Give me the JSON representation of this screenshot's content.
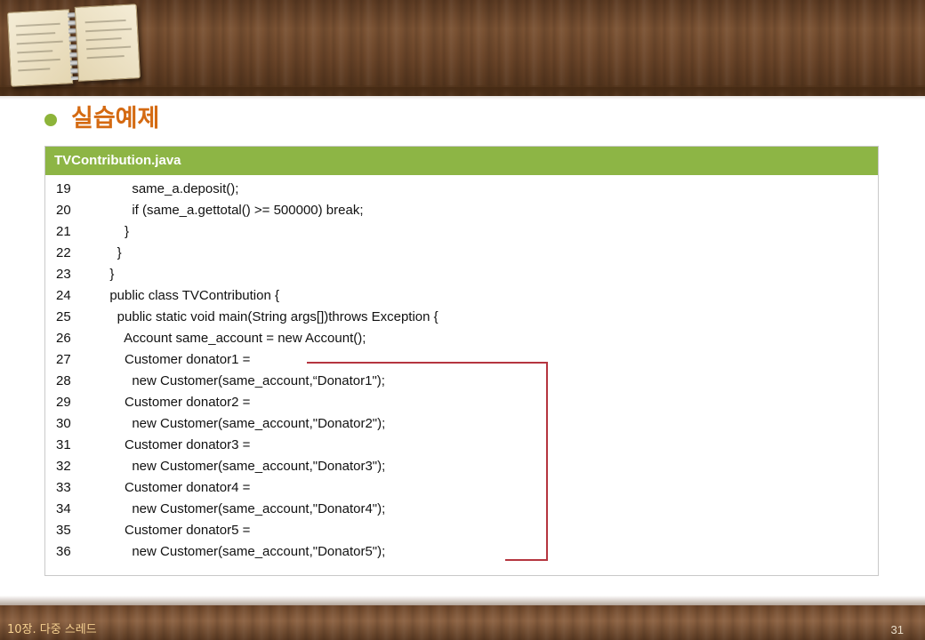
{
  "slide": {
    "title": "실습예제",
    "footer_chapter": "10장. 다중 스레드",
    "page_number": "31"
  },
  "code_box": {
    "filename": "TVContribution.java",
    "lines": [
      {
        "no": "19",
        "code": "        same_a.deposit();"
      },
      {
        "no": "20",
        "code": "        if (same_a.gettotal() >= 500000) break;"
      },
      {
        "no": "21",
        "code": "      }"
      },
      {
        "no": "22",
        "code": "    }"
      },
      {
        "no": "23",
        "code": "  }"
      },
      {
        "no": "24",
        "code": "  public class TVContribution {"
      },
      {
        "no": "25",
        "code": "    public static void main(String args[])throws Exception {"
      },
      {
        "no": "26",
        "code": "      Account same_account = new Account();"
      },
      {
        "no": "27",
        "code": "      Customer donator1 ="
      },
      {
        "no": "28",
        "code": "        new Customer(same_account,“Donator1\");"
      },
      {
        "no": "29",
        "code": "      Customer donator2 ="
      },
      {
        "no": "30",
        "code": "        new Customer(same_account,\"Donator2\");"
      },
      {
        "no": "31",
        "code": "      Customer donator3 ="
      },
      {
        "no": "32",
        "code": "        new Customer(same_account,\"Donator3\");"
      },
      {
        "no": "33",
        "code": "      Customer donator4 ="
      },
      {
        "no": "34",
        "code": "        new Customer(same_account,\"Donator4\");"
      },
      {
        "no": "35",
        "code": "      Customer donator5 ="
      },
      {
        "no": "36",
        "code": "        new Customer(same_account,\"Donator5\");"
      }
    ]
  },
  "colors": {
    "header_green": "#8db545",
    "title_orange": "#d46a12",
    "bullet_green": "#8db43a",
    "bracket_red": "#b5353f"
  }
}
